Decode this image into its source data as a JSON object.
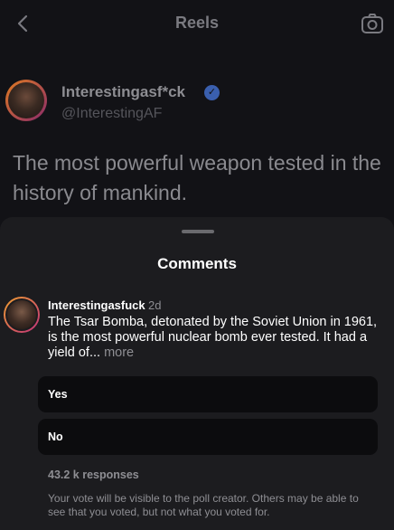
{
  "header": {
    "title": "Reels",
    "back_icon": "chevron-left-icon",
    "camera_icon": "camera-icon"
  },
  "post": {
    "author_name": "Interestingasf*ck",
    "handle": "@InterestingAF",
    "text": "The most powerful weapon tested in the history of mankind."
  },
  "comments_sheet": {
    "title": "Comments",
    "comment": {
      "username": "Interestingasfuck",
      "time": "2d",
      "text": "The Tsar Bomba, detonated by the Soviet Union in 1961, is the most powerful nuclear bomb ever tested. It had a yield of...",
      "more_label": "more"
    },
    "poll": {
      "options": [
        {
          "label": "Yes"
        },
        {
          "label": "No"
        }
      ],
      "responses": "43.2 k responses",
      "note": "Your vote will be visible to the poll creator. Others may be able to see that you voted, but not what you voted for."
    }
  }
}
